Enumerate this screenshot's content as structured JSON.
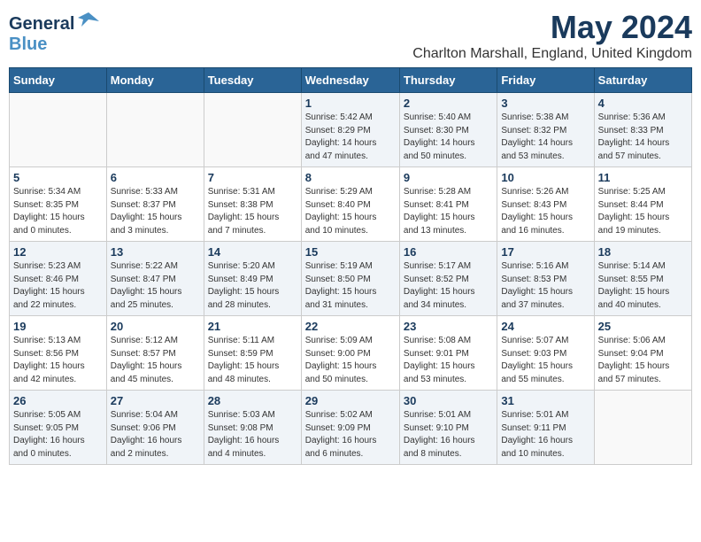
{
  "logo": {
    "line1": "General",
    "line2": "Blue",
    "symbol": "▶"
  },
  "title": "May 2024",
  "location": "Charlton Marshall, England, United Kingdom",
  "weekdays": [
    "Sunday",
    "Monday",
    "Tuesday",
    "Wednesday",
    "Thursday",
    "Friday",
    "Saturday"
  ],
  "weeks": [
    [
      {
        "day": "",
        "info": ""
      },
      {
        "day": "",
        "info": ""
      },
      {
        "day": "",
        "info": ""
      },
      {
        "day": "1",
        "info": "Sunrise: 5:42 AM\nSunset: 8:29 PM\nDaylight: 14 hours\nand 47 minutes."
      },
      {
        "day": "2",
        "info": "Sunrise: 5:40 AM\nSunset: 8:30 PM\nDaylight: 14 hours\nand 50 minutes."
      },
      {
        "day": "3",
        "info": "Sunrise: 5:38 AM\nSunset: 8:32 PM\nDaylight: 14 hours\nand 53 minutes."
      },
      {
        "day": "4",
        "info": "Sunrise: 5:36 AM\nSunset: 8:33 PM\nDaylight: 14 hours\nand 57 minutes."
      }
    ],
    [
      {
        "day": "5",
        "info": "Sunrise: 5:34 AM\nSunset: 8:35 PM\nDaylight: 15 hours\nand 0 minutes."
      },
      {
        "day": "6",
        "info": "Sunrise: 5:33 AM\nSunset: 8:37 PM\nDaylight: 15 hours\nand 3 minutes."
      },
      {
        "day": "7",
        "info": "Sunrise: 5:31 AM\nSunset: 8:38 PM\nDaylight: 15 hours\nand 7 minutes."
      },
      {
        "day": "8",
        "info": "Sunrise: 5:29 AM\nSunset: 8:40 PM\nDaylight: 15 hours\nand 10 minutes."
      },
      {
        "day": "9",
        "info": "Sunrise: 5:28 AM\nSunset: 8:41 PM\nDaylight: 15 hours\nand 13 minutes."
      },
      {
        "day": "10",
        "info": "Sunrise: 5:26 AM\nSunset: 8:43 PM\nDaylight: 15 hours\nand 16 minutes."
      },
      {
        "day": "11",
        "info": "Sunrise: 5:25 AM\nSunset: 8:44 PM\nDaylight: 15 hours\nand 19 minutes."
      }
    ],
    [
      {
        "day": "12",
        "info": "Sunrise: 5:23 AM\nSunset: 8:46 PM\nDaylight: 15 hours\nand 22 minutes."
      },
      {
        "day": "13",
        "info": "Sunrise: 5:22 AM\nSunset: 8:47 PM\nDaylight: 15 hours\nand 25 minutes."
      },
      {
        "day": "14",
        "info": "Sunrise: 5:20 AM\nSunset: 8:49 PM\nDaylight: 15 hours\nand 28 minutes."
      },
      {
        "day": "15",
        "info": "Sunrise: 5:19 AM\nSunset: 8:50 PM\nDaylight: 15 hours\nand 31 minutes."
      },
      {
        "day": "16",
        "info": "Sunrise: 5:17 AM\nSunset: 8:52 PM\nDaylight: 15 hours\nand 34 minutes."
      },
      {
        "day": "17",
        "info": "Sunrise: 5:16 AM\nSunset: 8:53 PM\nDaylight: 15 hours\nand 37 minutes."
      },
      {
        "day": "18",
        "info": "Sunrise: 5:14 AM\nSunset: 8:55 PM\nDaylight: 15 hours\nand 40 minutes."
      }
    ],
    [
      {
        "day": "19",
        "info": "Sunrise: 5:13 AM\nSunset: 8:56 PM\nDaylight: 15 hours\nand 42 minutes."
      },
      {
        "day": "20",
        "info": "Sunrise: 5:12 AM\nSunset: 8:57 PM\nDaylight: 15 hours\nand 45 minutes."
      },
      {
        "day": "21",
        "info": "Sunrise: 5:11 AM\nSunset: 8:59 PM\nDaylight: 15 hours\nand 48 minutes."
      },
      {
        "day": "22",
        "info": "Sunrise: 5:09 AM\nSunset: 9:00 PM\nDaylight: 15 hours\nand 50 minutes."
      },
      {
        "day": "23",
        "info": "Sunrise: 5:08 AM\nSunset: 9:01 PM\nDaylight: 15 hours\nand 53 minutes."
      },
      {
        "day": "24",
        "info": "Sunrise: 5:07 AM\nSunset: 9:03 PM\nDaylight: 15 hours\nand 55 minutes."
      },
      {
        "day": "25",
        "info": "Sunrise: 5:06 AM\nSunset: 9:04 PM\nDaylight: 15 hours\nand 57 minutes."
      }
    ],
    [
      {
        "day": "26",
        "info": "Sunrise: 5:05 AM\nSunset: 9:05 PM\nDaylight: 16 hours\nand 0 minutes."
      },
      {
        "day": "27",
        "info": "Sunrise: 5:04 AM\nSunset: 9:06 PM\nDaylight: 16 hours\nand 2 minutes."
      },
      {
        "day": "28",
        "info": "Sunrise: 5:03 AM\nSunset: 9:08 PM\nDaylight: 16 hours\nand 4 minutes."
      },
      {
        "day": "29",
        "info": "Sunrise: 5:02 AM\nSunset: 9:09 PM\nDaylight: 16 hours\nand 6 minutes."
      },
      {
        "day": "30",
        "info": "Sunrise: 5:01 AM\nSunset: 9:10 PM\nDaylight: 16 hours\nand 8 minutes."
      },
      {
        "day": "31",
        "info": "Sunrise: 5:01 AM\nSunset: 9:11 PM\nDaylight: 16 hours\nand 10 minutes."
      },
      {
        "day": "",
        "info": ""
      }
    ]
  ]
}
